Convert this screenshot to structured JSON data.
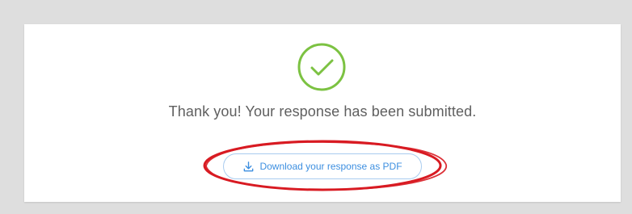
{
  "confirmation": {
    "message": "Thank you! Your response has been submitted.",
    "download_label": "Download your response as PDF"
  },
  "colors": {
    "background": "#dedede",
    "card": "#ffffff",
    "success_green": "#7cc242",
    "link_blue": "#3d8fe0",
    "annotation_red": "#d81b22"
  },
  "icons": {
    "success": "check-circle-icon",
    "download": "download-icon"
  }
}
